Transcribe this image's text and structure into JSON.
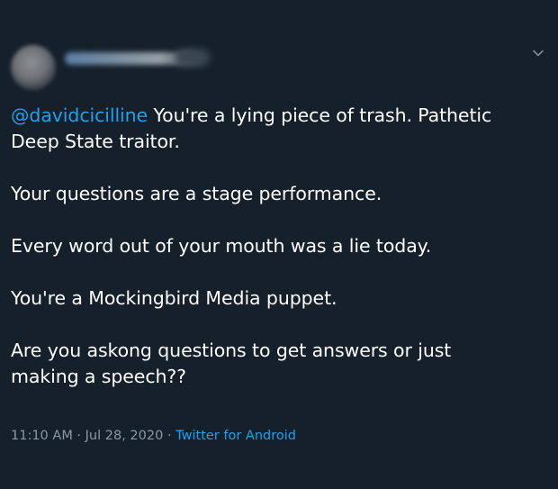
{
  "tweet": {
    "mention": "@davidcicilline",
    "line1_rest": " You're a lying piece of trash. Pathetic",
    "line2": "Deep State traitor.",
    "para2": "Your questions are a stage performance.",
    "para3": "Every word out of your mouth was a lie today.",
    "para4": "You're a Mockingbird Media puppet.",
    "para5_line1": "Are you askong questions to get answers or just",
    "para5_line2": "making a speech??",
    "time": "11:10 AM",
    "sep": " · ",
    "date": "Jul 28, 2020",
    "source": "Twitter for Android"
  },
  "icons": {
    "menu": "chevron-down-icon"
  },
  "colors": {
    "background": "#15202b",
    "text": "#ffffff",
    "link": "#1da1f2",
    "meta": "#8899a6"
  }
}
